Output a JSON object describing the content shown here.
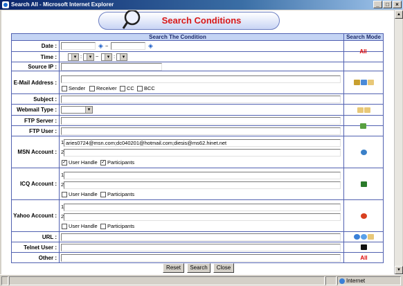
{
  "window": {
    "title": "Search All - Microsoft Internet Explorer",
    "buttons": [
      "_",
      "□",
      "×"
    ]
  },
  "banner": {
    "title": "Search Conditions",
    "icon": "magnifier-icon"
  },
  "table": {
    "col_condition": "Search The Condition",
    "col_mode": "Search Mode",
    "rows": {
      "date": {
        "label": "Date :",
        "sep": "~",
        "mode": "All"
      },
      "time": {
        "label": "Time :",
        "sep": "~",
        "colon": ":"
      },
      "source_ip": {
        "label": "Source IP :"
      },
      "email": {
        "label": "E-Mail Address :",
        "checks": [
          "Sender",
          "Receiver",
          "CC",
          "BCC"
        ]
      },
      "subject": {
        "label": "Subject :"
      },
      "webmail": {
        "label": "Webmail Type :"
      },
      "ftp_server": {
        "label": "FTP Server :"
      },
      "ftp_user": {
        "label": "FTP User :"
      },
      "msn": {
        "label": "MSN Account :",
        "line1_num": "1.",
        "line2_num": "2.",
        "line1_value": "aries0724@msn.com;dc040201@hotmail.com;diesis@ms62.hinet.net",
        "line2_value": "",
        "check_user": "User Handle",
        "check_part": "Participants",
        "user_checked": true,
        "part_checked": true
      },
      "icq": {
        "label": "ICQ Account :",
        "line1_num": "1.",
        "line2_num": "2.",
        "check_user": "User Handle",
        "check_part": "Participants"
      },
      "yahoo": {
        "label": "Yahoo Account :",
        "line1_num": "1.",
        "line2_num": "2.",
        "check_user": "User Handle",
        "check_part": "Participants"
      },
      "url": {
        "label": "URL :"
      },
      "telnet": {
        "label": "Telnet User :"
      },
      "other": {
        "label": "Other :",
        "mode": "All"
      }
    }
  },
  "actions": {
    "reset": "Reset",
    "search": "Search",
    "close": "Close"
  },
  "status": {
    "zone": "Internet"
  },
  "colors": {
    "accent": "#d81818",
    "grid": "#5060b0",
    "header_bg": "#c4d4f4"
  }
}
